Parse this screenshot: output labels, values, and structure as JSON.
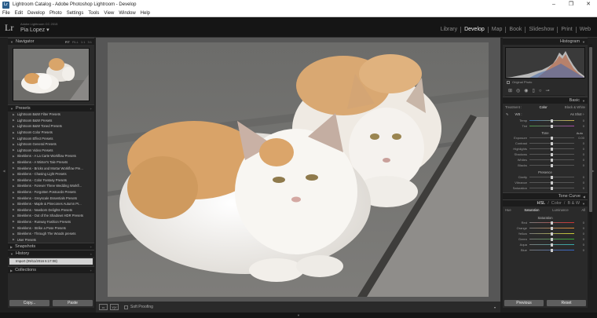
{
  "window": {
    "title": "Lightroom Catalog - Adobe Photoshop Lightroom - Develop",
    "logo_text": "Lr",
    "min": "–",
    "max": "❐",
    "close": "✕"
  },
  "menu": [
    "File",
    "Edit",
    "Develop",
    "Photo",
    "Settings",
    "Tools",
    "View",
    "Window",
    "Help"
  ],
  "identity": {
    "logo": "Lr",
    "subtitle": "Adobe Lightroom CC 2015",
    "user": "Pia Lopez ▾"
  },
  "modules": [
    {
      "label": "Library",
      "active": false
    },
    {
      "label": "Develop",
      "active": true
    },
    {
      "label": "Map",
      "active": false
    },
    {
      "label": "Book",
      "active": false
    },
    {
      "label": "Slideshow",
      "active": false
    },
    {
      "label": "Print",
      "active": false
    },
    {
      "label": "Web",
      "active": false
    }
  ],
  "left_panel": {
    "navigator": {
      "title": "Navigator",
      "zoom": [
        "FIT",
        "FILL",
        "1:1",
        "3:1"
      ]
    },
    "presets": {
      "title": "Presets",
      "add": "+",
      "items": [
        "Lightroom B&W Filter Presets",
        "Lightroom B&W Presets",
        "Lightroom B&W Toned Presets",
        "Lightroom Color Presets",
        "Lightroom Effect Presets",
        "Lightroom General Presets",
        "Lightroom Video Presets",
        "Sleeklens - A La Carte Workflow Presets",
        "Sleeklens - A Winter's Tale Presets",
        "Sleeklens - Bricks and Mortar Workflow Pre...",
        "Sleeklens - Chasing Light Presets",
        "Sleeklens - Color Fantasy Presets",
        "Sleeklens - Forever Three Wedding Workfl...",
        "Sleeklens - Forgotten Postcards Presets",
        "Sleeklens - Greyscale Essentials Presets",
        "Sleeklens - Maple & Pinecones Autumn Pr...",
        "Sleeklens - Newborn Delights Presets",
        "Sleeklens - Out of the Shadows HDR Presets",
        "Sleeklens - Runway Fashion Presets",
        "Sleeklens - Strike a Pose Presets",
        "Sleeklens - Through The Woods presets",
        "User Presets"
      ]
    },
    "snapshots": {
      "title": "Snapshots",
      "add": "+"
    },
    "history": {
      "title": "History",
      "close": "×",
      "items": [
        "Import (09/11/2016 6:17:08)"
      ]
    },
    "collections": {
      "title": "Collections",
      "add": "+"
    },
    "copy_label": "Copy...",
    "paste_label": "Paste"
  },
  "toolbar": {
    "soft_proofing": "Soft Proofing",
    "compare_label": "Y|Y",
    "dropdown": "▾"
  },
  "right_panel": {
    "histogram": {
      "title": "Histogram"
    },
    "original_photo": "Original Photo",
    "basic": {
      "title": "Basic",
      "treatment_label": "Treatment :",
      "treatment_color": "Color",
      "treatment_bw": "Black & White",
      "wb_label": "WB :",
      "wb_value": "As Shot ÷",
      "temp_label": "Temp",
      "tint_label": "Tint",
      "tone_label": "Tone",
      "auto_label": "Auto",
      "exposure_label": "Exposure",
      "exposure_value": "0.00",
      "contrast_label": "Contrast",
      "highlights_label": "Highlights",
      "shadows_label": "Shadows",
      "whites_label": "Whites",
      "blacks_label": "Blacks",
      "presence_label": "Presence",
      "clarity_label": "Clarity",
      "vibrance_label": "Vibrance",
      "saturation_label": "Saturation",
      "zero": "0"
    },
    "tone_curve": {
      "title": "Tone Curve"
    },
    "hsl": {
      "title_hsl": "HSL",
      "title_color": "Color",
      "title_bw": "B & W",
      "sep": "/",
      "tab_hue": "Hue",
      "tab_saturation": "Saturation",
      "tab_luminance": "Luminance",
      "tab_all": "All",
      "section": "Saturation",
      "red": "Red",
      "orange": "Orange",
      "yellow": "Yellow",
      "green": "Green",
      "aqua": "Aqua",
      "blue": "Blue",
      "zero": "0"
    },
    "previous_label": "Previous",
    "reset_label": "Reset"
  }
}
